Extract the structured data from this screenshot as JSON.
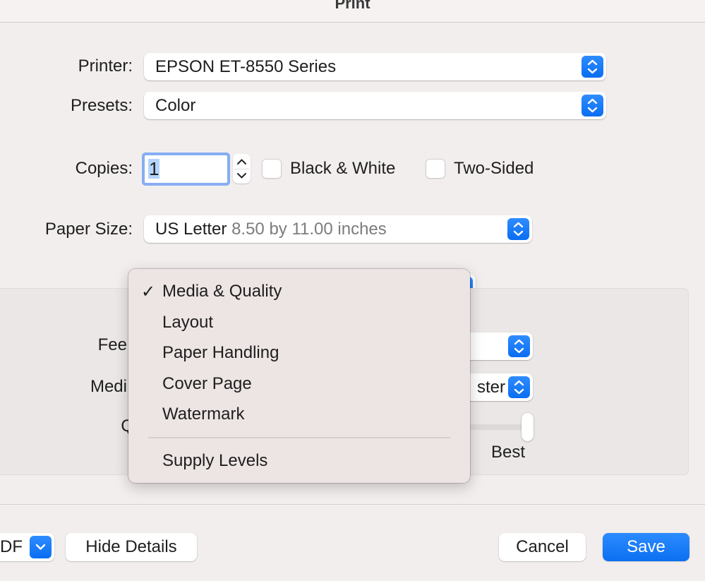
{
  "window": {
    "title": "Print"
  },
  "printer": {
    "label": "Printer:",
    "value": "EPSON ET-8550 Series"
  },
  "presets": {
    "label": "Presets:",
    "value": "Color"
  },
  "copies": {
    "label": "Copies:",
    "value": "1"
  },
  "options": {
    "black_white": {
      "label": "Black & White",
      "checked": false
    },
    "two_sided": {
      "label": "Two-Sided",
      "checked": false
    }
  },
  "paper_size": {
    "label": "Paper Size:",
    "value": "US Letter",
    "detail": "8.50 by 11.00 inches"
  },
  "details_panel": {
    "feed_label_partial": "Fee",
    "media_label_partial": "Medi",
    "quality_label_partial": "Q",
    "media_value_partial": "ster",
    "quality_slider": {
      "max_label": "Best",
      "value_fraction": 1.0
    }
  },
  "section_menu": {
    "selected": "Media & Quality",
    "items": [
      {
        "label": "Media & Quality",
        "checked": true
      },
      {
        "label": "Layout",
        "checked": false
      },
      {
        "label": "Paper Handling",
        "checked": false
      },
      {
        "label": "Cover Page",
        "checked": false
      },
      {
        "label": "Watermark",
        "checked": false
      }
    ],
    "extra_items": [
      {
        "label": "Supply Levels"
      }
    ],
    "check_glyph": "✓"
  },
  "footer": {
    "pdf_label_partial": "DF",
    "hide_details": "Hide Details",
    "cancel": "Cancel",
    "save": "Save"
  },
  "colors": {
    "accent": "#0a6ef2",
    "background": "#f3eeee"
  }
}
